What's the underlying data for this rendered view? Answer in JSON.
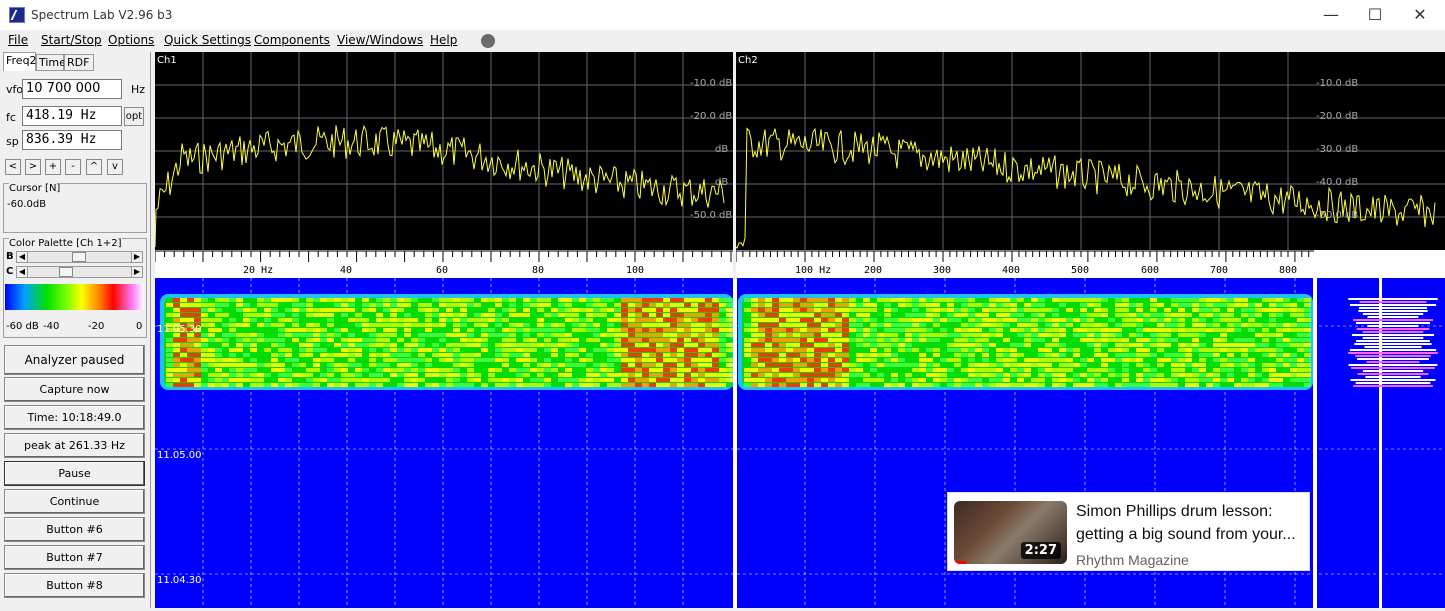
{
  "window": {
    "title": "Spectrum Lab V2.96 b3",
    "minimize": "—",
    "maximize": "☐",
    "close": "✕"
  },
  "menu": [
    "File",
    "Start/Stop",
    "Options",
    "Quick Settings",
    "Components",
    "View/Windows",
    "Help"
  ],
  "tabs": [
    "Freq2",
    "Time",
    "RDF"
  ],
  "freq": {
    "vfo_label": "vfo",
    "vfo_value": "10 700 000",
    "vfo_unit": "Hz",
    "fc_label": "fc",
    "fc_value": "418.19 Hz",
    "opt_label": "opt",
    "sp_label": "sp",
    "sp_value": "836.39 Hz"
  },
  "step_buttons": [
    "<",
    ">",
    "+",
    "-",
    "^",
    "v"
  ],
  "cursor": {
    "title": "Cursor [N]",
    "value": "-60.0dB"
  },
  "palette": {
    "title": "Color Palette [Ch 1+2]",
    "b_label": "B",
    "c_label": "C",
    "ticks": [
      "-60 dB",
      "-40",
      "-20",
      "0"
    ],
    "b_level": 0.5,
    "c_level": 0.35
  },
  "buttons": {
    "analyzer": "Analyzer paused",
    "capture": "Capture now",
    "time": "Time:  10:18:49.0",
    "peak": "peak at 261.33 Hz",
    "pause": "Pause",
    "continue": "Continue",
    "b6": "Button #6",
    "b7": "Button #7",
    "b8": "Button #8"
  },
  "spectrum": {
    "ch1_label": "Ch1",
    "ch2_label": "Ch2",
    "db_labels": [
      "-10.0 dB",
      "-20.0 dB",
      "-30.0 dB",
      "-40.0 dB",
      "-50.0 dB"
    ],
    "ch1_db_labels": [
      "-10.0 dB",
      "-20.0 dB",
      "dB",
      "dB",
      "-50.0 dB"
    ],
    "ch1_x_labels": [
      "20 Hz",
      "40",
      "60",
      "80",
      "100"
    ],
    "ch2_x_labels": [
      "100 Hz",
      "200",
      "300",
      "400",
      "500",
      "600",
      "700",
      "800"
    ]
  },
  "waterfall": {
    "time_labels": [
      "11.05.30",
      "11.05.00",
      "11.04.30"
    ]
  },
  "overlay": {
    "title": "Simon Phillips drum lesson: getting a big sound from your...",
    "channel": "Rhythm Magazine",
    "duration": "2:27"
  },
  "colors": {
    "trace": "#ffff40",
    "waterfall_bg": "#0000ff",
    "grid": "#808080"
  }
}
